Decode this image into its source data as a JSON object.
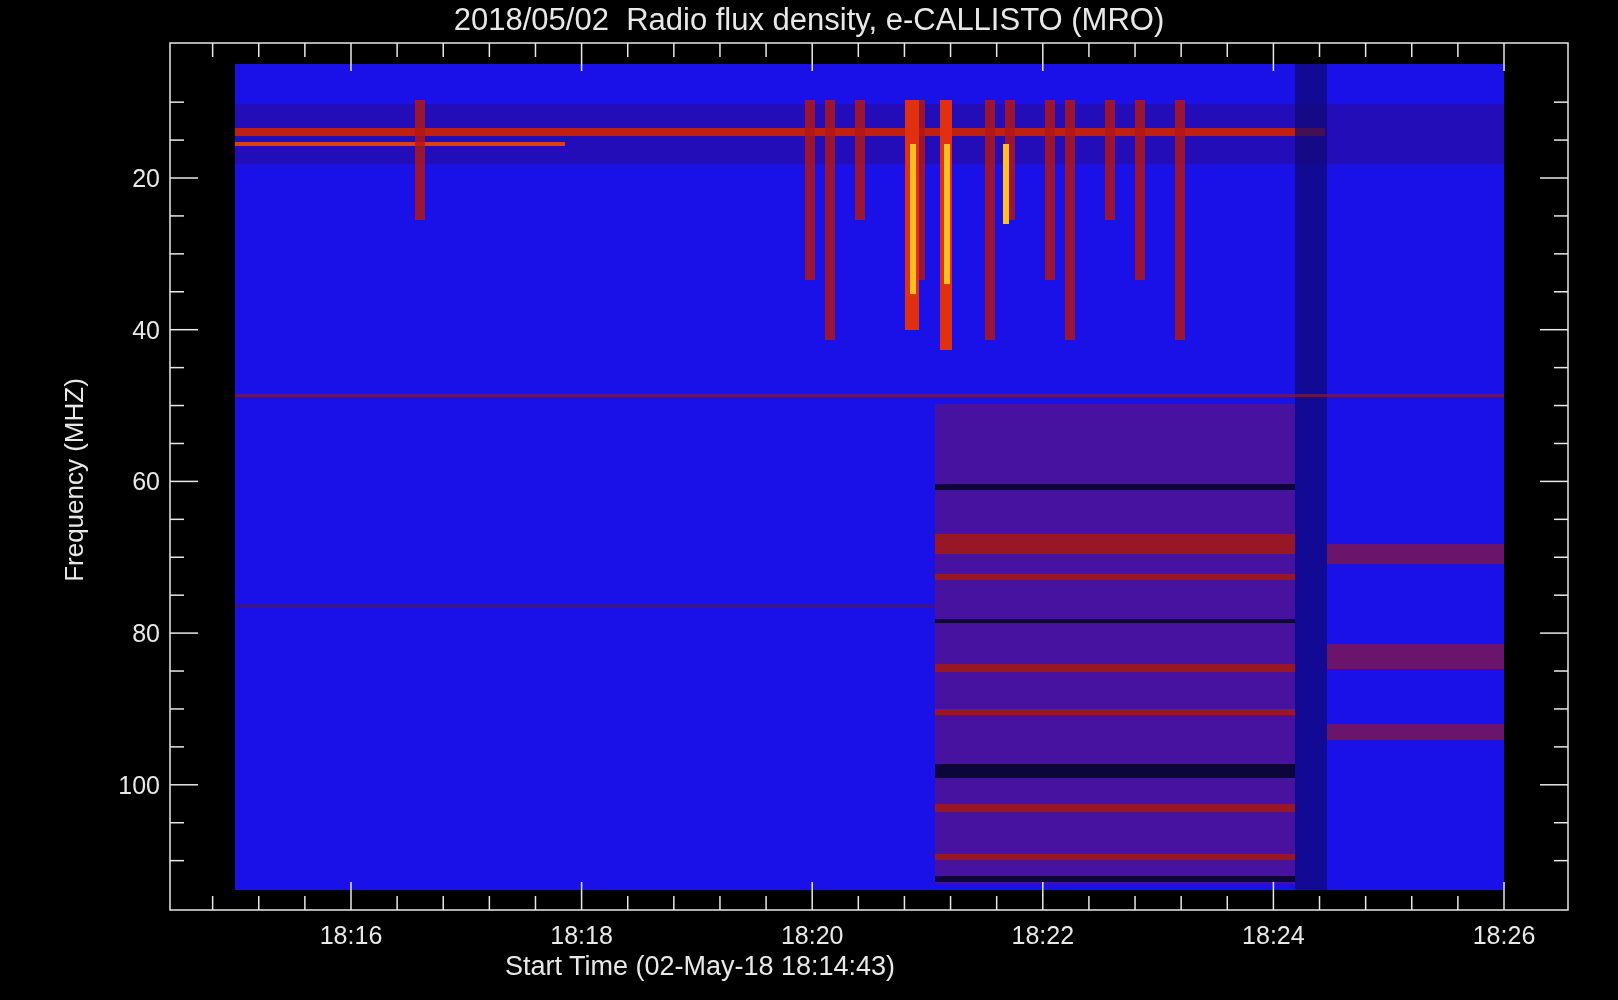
{
  "title": "2018/05/02  Radio flux density, e-CALLISTO (MRO)",
  "ylabel": "Frequency (MHZ)",
  "xlabel": "Start Time (02-May-18 18:14:43)",
  "yticks": [
    "20",
    "40",
    "60",
    "80",
    "100"
  ],
  "xticks": [
    "18:16",
    "18:18",
    "18:20",
    "18:22",
    "18:24",
    "18:26"
  ]
}
